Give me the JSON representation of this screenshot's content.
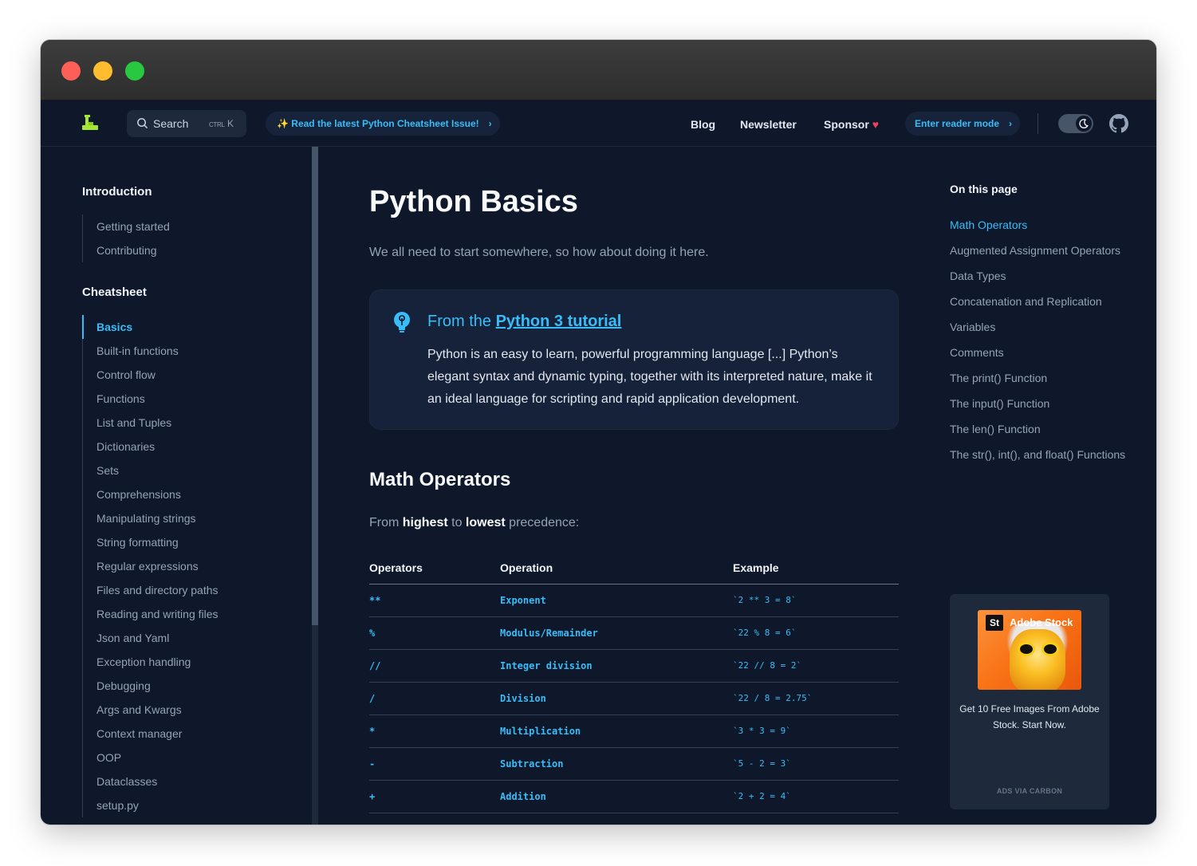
{
  "nav": {
    "search_label": "Search",
    "search_kbd_ctrl": "CTRL",
    "search_kbd_key": "K",
    "promo_label": "✨ Read the latest Python Cheatsheet Issue!",
    "blog": "Blog",
    "newsletter": "Newsletter",
    "sponsor": "Sponsor",
    "reader_mode": "Enter reader mode"
  },
  "sidebar": {
    "intro_heading": "Introduction",
    "intro_items": [
      "Getting started",
      "Contributing"
    ],
    "cheatsheet_heading": "Cheatsheet",
    "cheatsheet_items": [
      "Basics",
      "Built-in functions",
      "Control flow",
      "Functions",
      "List and Tuples",
      "Dictionaries",
      "Sets",
      "Comprehensions",
      "Manipulating strings",
      "String formatting",
      "Regular expressions",
      "Files and directory paths",
      "Reading and writing files",
      "Json and Yaml",
      "Exception handling",
      "Debugging",
      "Args and Kwargs",
      "Context manager",
      "OOP",
      "Dataclasses",
      "setup.py"
    ],
    "active": "Basics"
  },
  "main": {
    "title": "Python Basics",
    "lead": "We all need to start somewhere, so how about doing it here.",
    "callout": {
      "title_prefix": "From the ",
      "title_link": "Python 3 tutorial",
      "body": "Python is an easy to learn, powerful programming language [...] Python’s elegant syntax and dynamic typing, together with its interpreted nature, make it an ideal language for scripting and rapid application development."
    },
    "section_title": "Math Operators",
    "precedence": {
      "from": "From",
      "highest": "highest",
      "to": "to",
      "lowest": "lowest",
      "rest": "precedence:"
    },
    "table": {
      "headers": [
        "Operators",
        "Operation",
        "Example"
      ],
      "rows": [
        [
          "**",
          "Exponent",
          "`2 ** 3 = 8`"
        ],
        [
          "%",
          "Modulus/Remainder",
          "`22 % 8 = 6`"
        ],
        [
          "//",
          "Integer division",
          "`22 // 8 = 2`"
        ],
        [
          "/",
          "Division",
          "`22 / 8 = 2.75`"
        ],
        [
          "*",
          "Multiplication",
          "`3 * 3 = 9`"
        ],
        [
          "-",
          "Subtraction",
          "`5 - 2 = 3`"
        ],
        [
          "+",
          "Addition",
          "`2 + 2 = 4`"
        ]
      ]
    }
  },
  "toc": {
    "heading": "On this page",
    "items": [
      "Math Operators",
      "Augmented Assignment Operators",
      "Data Types",
      "Concatenation and Replication",
      "Variables",
      "Comments",
      "The print() Function",
      "The input() Function",
      "The len() Function",
      "The str(), int(), and float() Functions"
    ],
    "active": "Math Operators"
  },
  "ad": {
    "badge": "St",
    "brand": "Adobe Stock",
    "text": "Get 10 Free Images From Adobe Stock. Start Now.",
    "via": "ADS VIA CARBON"
  },
  "colors": {
    "accent": "#38bdf8",
    "background": "#0f172a",
    "heart": "#f43f5e"
  },
  "icons": [
    "logo-icon",
    "search-icon",
    "chevron-right-icon",
    "heart-icon",
    "moon-icon",
    "github-icon",
    "lightbulb-icon"
  ]
}
